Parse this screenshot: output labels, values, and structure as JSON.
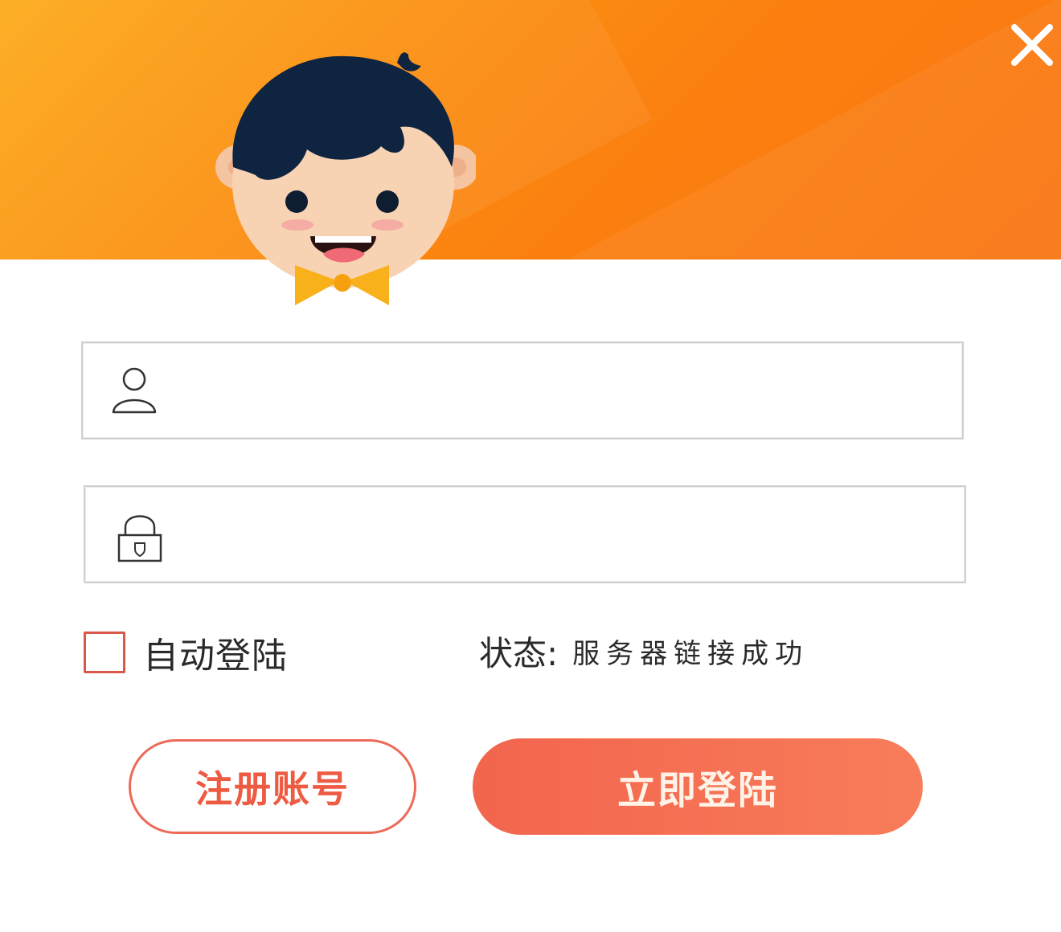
{
  "window": {
    "close_icon": "close-icon",
    "accent_color": "#fb8a12",
    "button_color": "#f36a52"
  },
  "mascot": {
    "icon": "boy-mascot-avatar"
  },
  "form": {
    "username": {
      "icon": "user-icon",
      "value": "",
      "placeholder": ""
    },
    "password": {
      "icon": "lock-icon",
      "value": "",
      "placeholder": ""
    },
    "auto_login": {
      "label": "自动登陆",
      "checked": false
    },
    "status": {
      "label": "状态:",
      "value": "服务器链接成功"
    }
  },
  "buttons": {
    "register_label": "注册账号",
    "login_label": "立即登陆"
  }
}
